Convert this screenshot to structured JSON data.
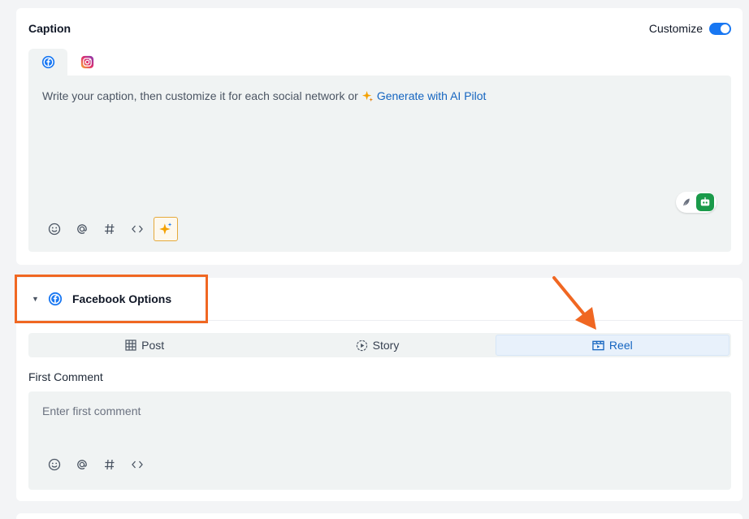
{
  "caption": {
    "title": "Caption",
    "customize_label": "Customize",
    "customize_on": true,
    "tabs": [
      {
        "icon": "facebook-icon",
        "active": true
      },
      {
        "icon": "instagram-icon",
        "active": false
      }
    ],
    "placeholder": "Write your caption, then customize it for each social network or",
    "ai_link": "Generate with AI Pilot",
    "tools": [
      "emoji-icon",
      "mention-icon",
      "hashtag-icon",
      "code-icon",
      "ai-sparkle-icon"
    ]
  },
  "facebook_options": {
    "title": "Facebook Options",
    "post_types": [
      {
        "label": "Post",
        "icon": "grid-icon",
        "active": false
      },
      {
        "label": "Story",
        "icon": "story-icon",
        "active": false
      },
      {
        "label": "Reel",
        "icon": "reel-icon",
        "active": true
      }
    ],
    "first_comment_label": "First Comment",
    "first_comment_placeholder": "Enter first comment",
    "tools": [
      "emoji-icon",
      "mention-icon",
      "hashtag-icon",
      "code-icon"
    ]
  },
  "colors": {
    "accent": "#1877f2",
    "link": "#1565c0",
    "highlight": "#f06722",
    "editor_bg": "#f0f3f3"
  }
}
